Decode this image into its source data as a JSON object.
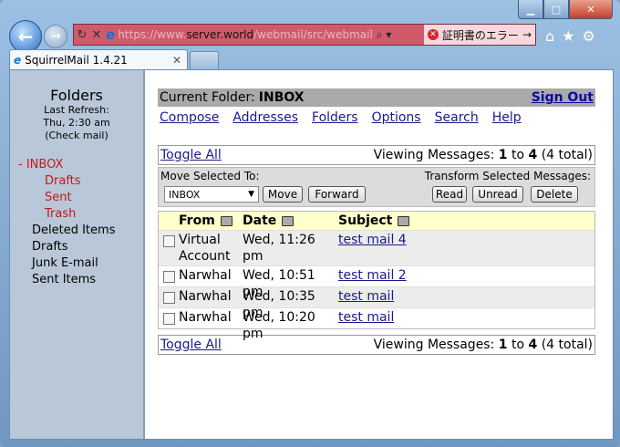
{
  "window": {
    "min": "▁",
    "max": "□",
    "close": "✕"
  },
  "browser": {
    "url_dim1": "https://www.",
    "url_host": "server.world",
    "url_dim2": "/webmail/src/webmail",
    "cert_error": "証明書のエラー",
    "tab_title": "SquirrelMail 1.4.21"
  },
  "sidebar": {
    "title": "Folders",
    "last_refresh_label": "Last Refresh:",
    "last_refresh_time": "Thu, 2:30 am",
    "check_mail": "Check mail",
    "folders": [
      {
        "label": "- INBOX",
        "type": "current"
      },
      {
        "label": "Drafts",
        "type": "sub"
      },
      {
        "label": "Sent",
        "type": "sub"
      },
      {
        "label": "Trash",
        "type": "sub"
      },
      {
        "label": "Deleted Items",
        "type": "top"
      },
      {
        "label": "Drafts",
        "type": "top"
      },
      {
        "label": "Junk E-mail",
        "type": "top"
      },
      {
        "label": "Sent Items",
        "type": "top"
      }
    ]
  },
  "header": {
    "current_folder_label": "Current Folder:",
    "current_folder": "INBOX",
    "sign_out": "Sign Out"
  },
  "menu": [
    "Compose",
    "Addresses",
    "Folders",
    "Options",
    "Search",
    "Help"
  ],
  "pager": {
    "toggle_all": "Toggle All",
    "viewing": "Viewing Messages: ",
    "from": "1",
    "to_word": " to ",
    "to": "4",
    "total": " (4 total)"
  },
  "controls": {
    "move_label": "Move Selected To:",
    "transform_label": "Transform Selected Messages:",
    "move_target": "INBOX",
    "move": "Move",
    "forward": "Forward",
    "read": "Read",
    "unread": "Unread",
    "delete": "Delete"
  },
  "table": {
    "headers": [
      "From",
      "Date",
      "Subject"
    ],
    "rows": [
      {
        "from": "Virtual Account",
        "date": "Wed, 11:26 pm",
        "subject": "test mail 4"
      },
      {
        "from": "Narwhal",
        "date": "Wed, 10:51 pm",
        "subject": "test mail 2"
      },
      {
        "from": "Narwhal",
        "date": "Wed, 10:35 pm",
        "subject": "test mail"
      },
      {
        "from": "Narwhal",
        "date": "Wed, 10:20 pm",
        "subject": "test mail"
      }
    ]
  }
}
